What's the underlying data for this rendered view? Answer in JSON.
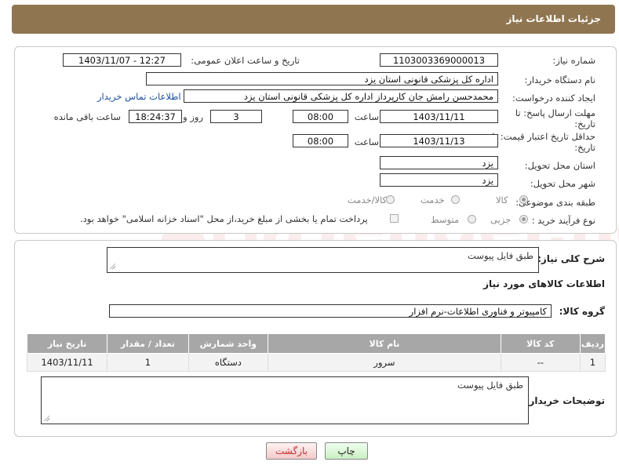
{
  "header": {
    "title": "جزئیات اطلاعات نیاز"
  },
  "labels": {
    "need_number": "شماره نیاز:",
    "announce_datetime": "تاریخ و ساعت اعلان عمومی:",
    "buyer_org": "نام دستگاه خریدار:",
    "creator": "ایجاد کننده درخواست:",
    "reply_deadline_1": "مهلت ارسال پاسخ: تا",
    "reply_deadline_2": "تاریخ:",
    "price_validity_1": "حداقل تاریخ اعتبار قیمت: تا",
    "price_validity_2": "تاریخ:",
    "time": "ساعت",
    "time2": "ساعت",
    "day_and": "روز و",
    "remaining": "ساعت باقی مانده",
    "delivery_province": "استان محل تحویل:",
    "delivery_city": "شهر محل تحویل:",
    "category": "طبقه بندی موضوعی:",
    "process_type": "نوع فرآیند خرید :",
    "need_description": "شرح کلی نیاز:",
    "goods_info": "اطلاعات کالاهای مورد نیاز",
    "goods_group": "گروه کالا:",
    "buyer_notes": "توضیحات خریدار:"
  },
  "values": {
    "need_number": "1103003369000013",
    "announce_datetime": "1403/11/07 - 12:27",
    "buyer_org": "اداره کل پزشکی قانونی استان یزد",
    "creator": "محمدحسن رامش جان کارپرداز اداره کل پزشکی قانونی استان یزد",
    "reply_date": "1403/11/11",
    "reply_time": "08:00",
    "days": "3",
    "remaining_time": "18:24:37",
    "validity_date": "1403/11/13",
    "validity_time": "08:00",
    "province": "یزد",
    "city": "یزد",
    "need_description": "طبق فایل پیوست",
    "goods_group": "کامپیوتر و فناوری اطلاعات-نرم افزار",
    "buyer_notes": "طبق فایل پیوست"
  },
  "contact_link": "اطلاعات تماس خریدار",
  "category_options": [
    {
      "label": "کالا",
      "selected": true
    },
    {
      "label": "خدمت",
      "selected": false
    },
    {
      "label": "کالا/خدمت",
      "selected": false
    }
  ],
  "process_options": [
    {
      "label": "جزیی",
      "selected": true
    },
    {
      "label": "متوسط",
      "selected": false
    }
  ],
  "payment_note": "پرداخت تمام یا بخشی از مبلغ خرید،از محل \"اسناد خزانه اسلامی\" خواهد بود.",
  "table": {
    "headers": [
      "ردیف",
      "کد کالا",
      "نام کالا",
      "واحد شمارش",
      "تعداد / مقدار",
      "تاریخ نیاز"
    ],
    "rows": [
      [
        "1",
        "--",
        "سرور",
        "دستگاه",
        "1",
        "1403/11/11"
      ]
    ]
  },
  "buttons": {
    "print": "چاپ",
    "back": "بازگشت"
  },
  "watermark": "AriaTender.neT"
}
